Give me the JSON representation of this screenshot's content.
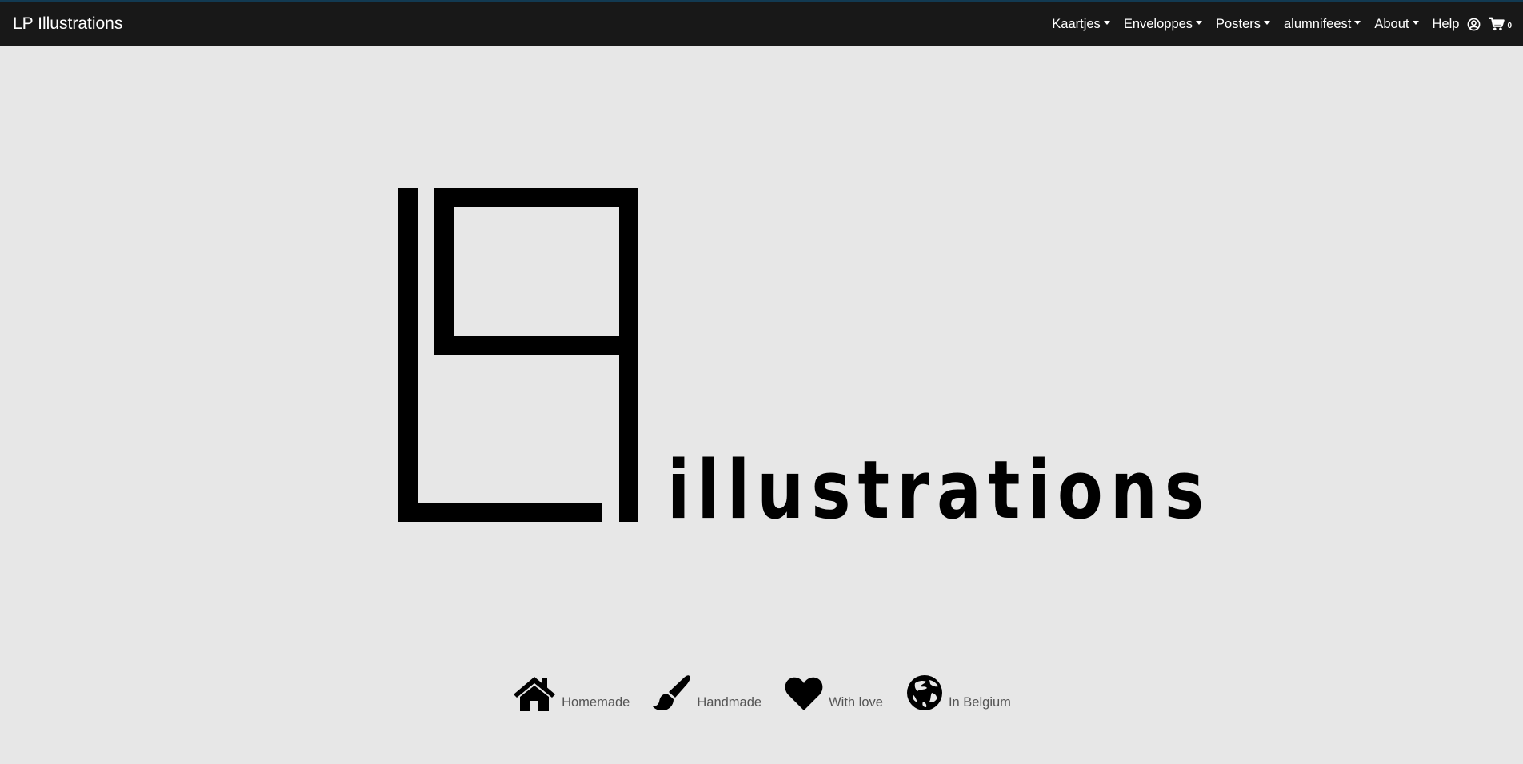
{
  "navbar": {
    "brand": "LP Illustrations",
    "menu": [
      {
        "label": "Kaartjes",
        "dropdown": true
      },
      {
        "label": "Enveloppes",
        "dropdown": true
      },
      {
        "label": "Posters",
        "dropdown": true
      },
      {
        "label": "alumnifeest",
        "dropdown": true
      },
      {
        "label": "About",
        "dropdown": true
      },
      {
        "label": "Help",
        "dropdown": false
      }
    ],
    "account_icon": "user-circle-icon",
    "cart_icon": "shopping-cart-icon",
    "cart_count": "0"
  },
  "hero": {
    "logo_text": "illustrations",
    "logo_monogram": "LP"
  },
  "features": [
    {
      "label": "Homemade",
      "icon": "home-icon"
    },
    {
      "label": "Handmade",
      "icon": "paintbrush-icon"
    },
    {
      "label": "With love",
      "icon": "heart-icon"
    },
    {
      "label": "In Belgium",
      "icon": "globe-icon"
    }
  ],
  "colors": {
    "navbar_bg": "#181818",
    "page_bg": "#e7e7e7",
    "logo": "#000000",
    "feature_text": "#555555"
  }
}
